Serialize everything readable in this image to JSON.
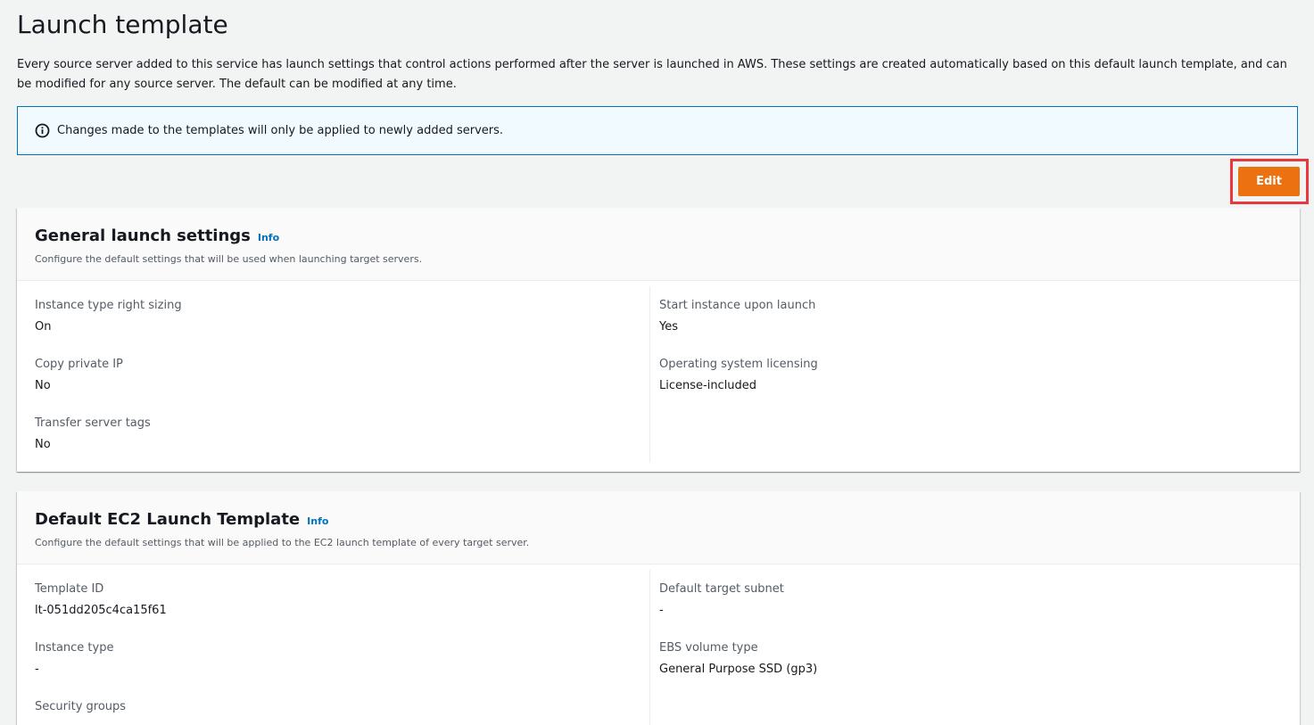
{
  "page": {
    "title": "Launch template",
    "description": "Every source server added to this service has launch settings that control actions performed after the server is launched in AWS. These settings are created automatically based on this default launch template, and can be modified for any source server. The default can be modified at any time."
  },
  "alert": {
    "icon": "info-circle-icon",
    "text": "Changes made to the templates will only be applied to newly added servers."
  },
  "actions": {
    "edit_label": "Edit"
  },
  "general_settings": {
    "title": "General launch settings",
    "info_label": "Info",
    "description": "Configure the default settings that will be used when launching target servers.",
    "left_fields": [
      {
        "label": "Instance type right sizing",
        "value": "On"
      },
      {
        "label": "Copy private IP",
        "value": "No"
      },
      {
        "label": "Transfer server tags",
        "value": "No"
      }
    ],
    "right_fields": [
      {
        "label": "Start instance upon launch",
        "value": "Yes"
      },
      {
        "label": "Operating system licensing",
        "value": "License-included"
      }
    ]
  },
  "ec2_template": {
    "title": "Default EC2 Launch Template",
    "info_label": "Info",
    "description": "Configure the default settings that will be applied to the EC2 launch template of every target server.",
    "left_fields": [
      {
        "label": "Template ID",
        "value": "lt-051dd205c4ca15f61"
      },
      {
        "label": "Instance type",
        "value": "-"
      },
      {
        "label": "Security groups",
        "value": ""
      }
    ],
    "right_fields": [
      {
        "label": "Default target subnet",
        "value": "-"
      },
      {
        "label": "EBS volume type",
        "value": "General Purpose SSD (gp3)"
      }
    ]
  },
  "colors": {
    "accent_orange": "#ec7211",
    "info_blue": "#0073bb",
    "highlight_red": "#e8383d",
    "page_background": "#f2f3f3"
  }
}
